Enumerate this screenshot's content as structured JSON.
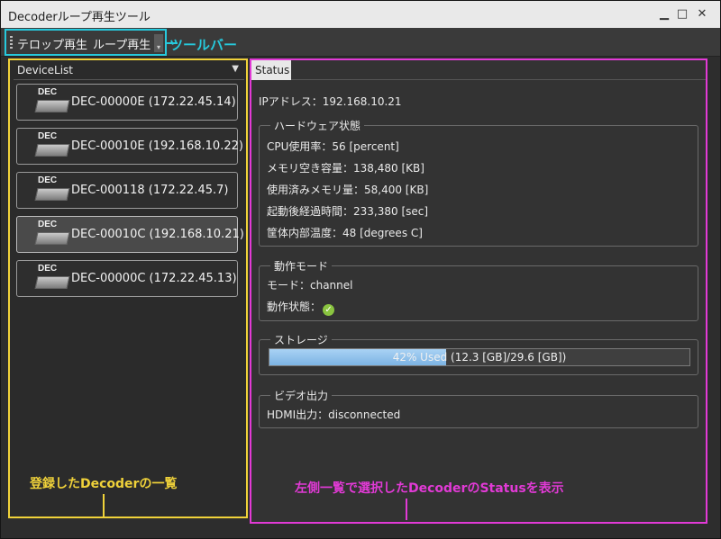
{
  "window": {
    "title": "Decoderループ再生ツール",
    "controls": [
      "minimize-icon",
      "maximize-icon",
      "close-icon"
    ]
  },
  "toolbar": {
    "buttons": [
      "テロップ再生",
      "ループ再生"
    ],
    "annotation": "ツールバー"
  },
  "device_list": {
    "title": "DeviceList",
    "items": [
      {
        "icon_label": "DEC",
        "name": "DEC-00000E (172.22.45.14)",
        "selected": false
      },
      {
        "icon_label": "DEC",
        "name": "DEC-00010E (192.168.10.22)",
        "selected": false
      },
      {
        "icon_label": "DEC",
        "name": "DEC-000118 (172.22.45.7)",
        "selected": false
      },
      {
        "icon_label": "DEC",
        "name": "DEC-00010C (192.168.10.21)",
        "selected": true
      },
      {
        "icon_label": "DEC",
        "name": "DEC-00000C (172.22.45.13)",
        "selected": false
      }
    ],
    "annotation": "登録したDecoderの一覧"
  },
  "status": {
    "tab": "Status",
    "ip": "IPアドレス：192.168.10.21",
    "hardware": {
      "title": "ハードウェア状態",
      "rows": [
        "CPU使用率：56 [percent]",
        "メモリ空き容量：138,480 [KB]",
        "使用済みメモリ量：58,400 [KB]",
        "起動後経過時間：233,380 [sec]",
        "筐体内部温度：48 [degrees C]"
      ]
    },
    "mode": {
      "title": "動作モード",
      "mode_row": "モード：channel",
      "state_label": "動作状態："
    },
    "storage": {
      "title": "ストレージ",
      "used_percent": 42,
      "text": "42% Used (12.3 [GB]/29.6 [GB])"
    },
    "video": {
      "title": "ビデオ出力",
      "hdmi": "HDMI出力：disconnected"
    },
    "annotation": "左側一覧で選択したDecoderのStatusを表示"
  },
  "colors": {
    "toolbar_annotation": "#27c9dc",
    "list_annotation": "#f0d23a",
    "status_annotation": "#e23ad6",
    "storage_fill": "#8fc3ee",
    "ok_check": "#8ac440"
  }
}
